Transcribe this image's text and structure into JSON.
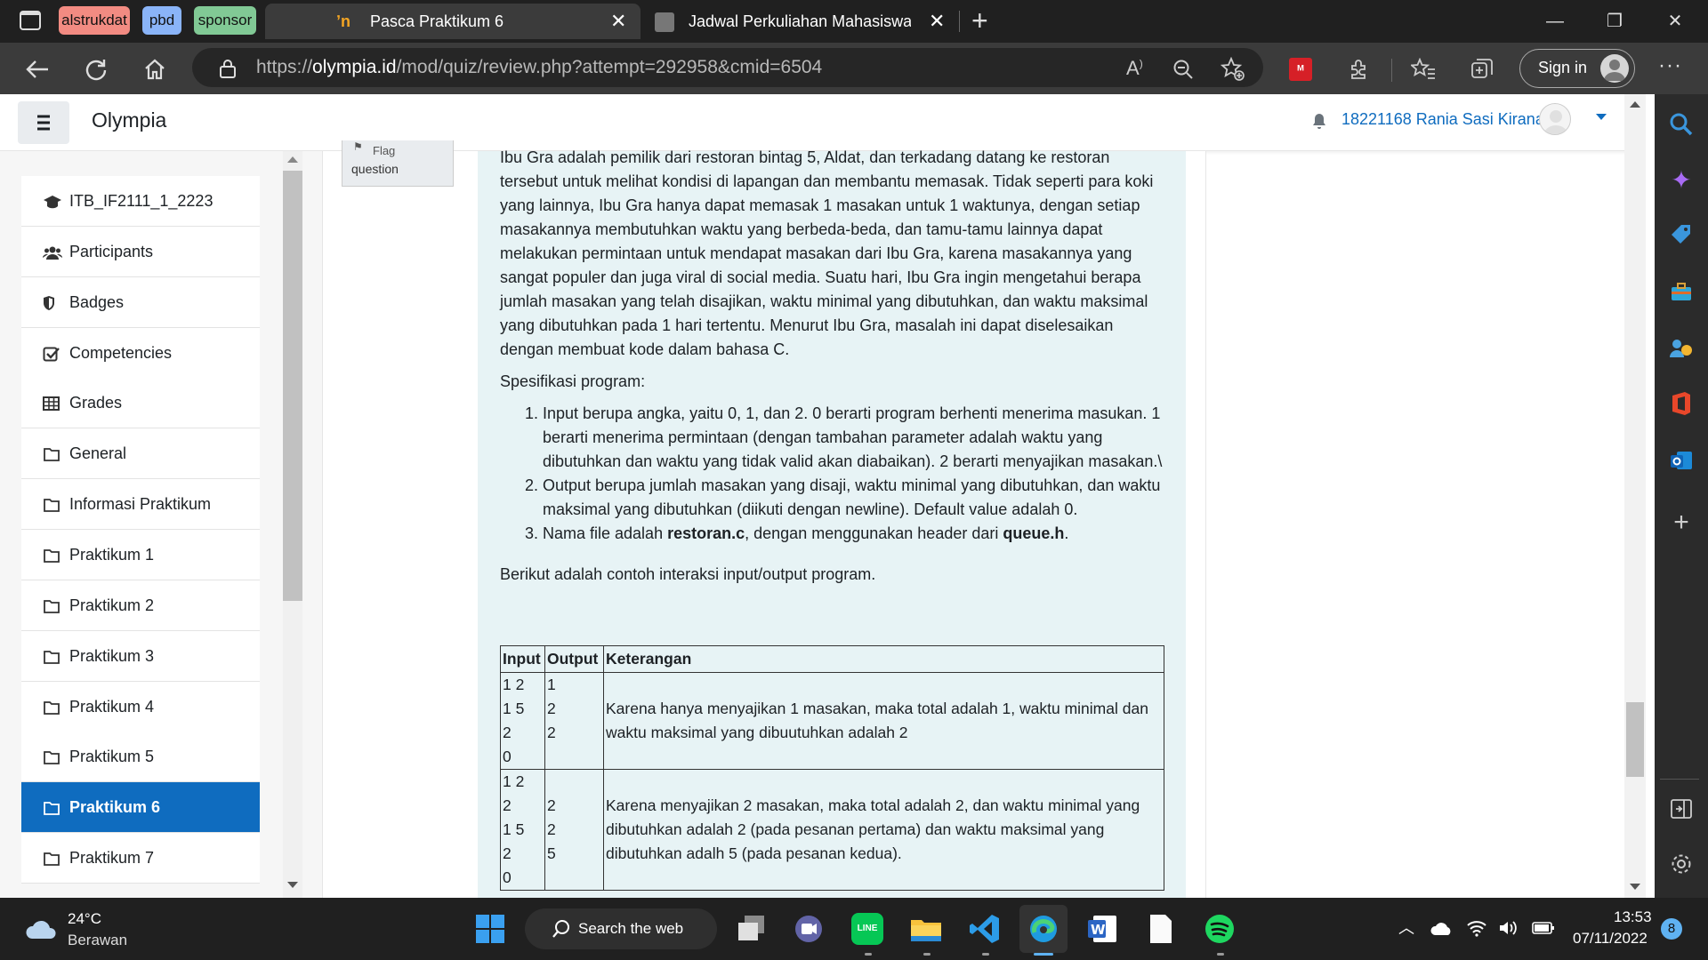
{
  "browser": {
    "tab_groups": [
      {
        "label": "alstrukdat",
        "color": "#f28b82"
      },
      {
        "label": "pbd",
        "color": "#8ab4f8"
      },
      {
        "label": "sponsor",
        "color": "#81c995"
      }
    ],
    "tabs": [
      {
        "title": "Pasca Praktikum 6",
        "active": true
      },
      {
        "title": "Jadwal Perkuliahan Mahasiswa | S",
        "active": false
      }
    ],
    "url_scheme": "https://",
    "url_host": "olympia.id",
    "url_path": "/mod/quiz/review.php?attempt=292958&cmid=6504",
    "sign_in_label": "Sign in"
  },
  "site": {
    "name": "Olympia",
    "user": "18221168 Rania Sasi Kirana"
  },
  "sidebar": {
    "items": [
      {
        "label": "ITB_IF2111_1_2223",
        "icon": "graduation-cap-icon",
        "active": false
      },
      {
        "label": "Participants",
        "icon": "users-icon",
        "active": false
      },
      {
        "label": "Badges",
        "icon": "shield-icon",
        "active": false
      },
      {
        "label": "Competencies",
        "icon": "checkbox-icon",
        "active": false
      },
      {
        "label": "Grades",
        "icon": "table-icon",
        "active": false
      },
      {
        "label": "General",
        "icon": "folder-icon",
        "active": false
      },
      {
        "label": "Informasi Praktikum",
        "icon": "folder-icon",
        "active": false
      },
      {
        "label": "Praktikum 1",
        "icon": "folder-icon",
        "active": false
      },
      {
        "label": "Praktikum 2",
        "icon": "folder-icon",
        "active": false
      },
      {
        "label": "Praktikum 3",
        "icon": "folder-icon",
        "active": false
      },
      {
        "label": "Praktikum 4",
        "icon": "folder-icon",
        "active": false
      },
      {
        "label": "Praktikum 5",
        "icon": "folder-icon",
        "active": false
      },
      {
        "label": "Praktikum 6",
        "icon": "folder-icon",
        "active": true
      },
      {
        "label": "Praktikum 7",
        "icon": "folder-icon",
        "active": false
      }
    ]
  },
  "question": {
    "flag_label_1": "Flag",
    "flag_label_2": "question",
    "intro_lines": [
      "Ibu Gra adalah pemilik dari restoran bintag 5, Aldat, dan terkadang datang ke restoran",
      "tersebut untuk melihat kondisi di lapangan dan membantu memasak. Tidak seperti para koki",
      "yang lainnya, Ibu Gra hanya dapat memasak 1 masakan untuk 1 waktunya, dengan setiap",
      "masakannya membutuhkan waktu yang berbeda-beda, dan tamu-tamu lainnya dapat",
      "melakukan permintaan untuk mendapat masakan dari Ibu Gra, karena masakannya yang",
      "sangat populer dan juga viral di social media. Suatu hari, Ibu Gra ingin mengetahui berapa",
      "jumlah masakan yang telah disajikan, waktu minimal yang dibutuhkan, dan waktu maksimal",
      "yang dibutuhkan pada 1 hari tertentu. Menurut Ibu Gra, masalah ini dapat diselesaikan",
      "dengan membuat kode dalam bahasa C."
    ],
    "spec_title": "Spesifikasi program:",
    "spec_items": [
      {
        "num": "1.",
        "lines": [
          "Input berupa angka, yaitu 0, 1, dan 2. 0 berarti program berhenti menerima masukan. 1",
          "berarti menerima permintaan (dengan tambahan parameter adalah waktu yang",
          "dibutuhkan dan waktu yang tidak valid akan diabaikan). 2 berarti menyajikan masakan.\\"
        ]
      },
      {
        "num": "2.",
        "lines": [
          "Output berupa jumlah masakan yang disaji, waktu minimal yang dibutuhkan, dan waktu",
          "maksimal yang dibutuhkan (diikuti dengan newline). Default value adalah 0."
        ]
      }
    ],
    "spec3": {
      "num": "3.",
      "a": "Nama file adalah ",
      "file": "restoran.c",
      "b": ", dengan menggunakan header dari ",
      "header": "queue.h",
      "c": "."
    },
    "example_intro": "Berikut adalah contoh interaksi input/output program.",
    "table": {
      "headers": [
        "Input",
        "Output",
        "Keterangan"
      ],
      "rows": [
        {
          "input": [
            "1 2",
            "1 5",
            "2",
            "0"
          ],
          "output": [
            "1",
            "2",
            "2"
          ],
          "note": [
            "Karena hanya menyajikan 1 masakan, maka total adalah 1, waktu minimal dan",
            "waktu maksimal yang dibuutuhkan adalah 2"
          ]
        },
        {
          "input": [
            "1 2",
            "2",
            "1 5",
            "2",
            "0"
          ],
          "output": [
            "2",
            "2",
            "5"
          ],
          "note": [
            "Karena menyajikan 2 masakan, maka total adalah 2, dan waktu minimal yang",
            "dibutuhkan adalah 2 (pada pesanan pertama) dan waktu maksimal yang",
            "dibutuhkan adalh 5 (pada pesanan kedua)."
          ]
        }
      ]
    }
  },
  "taskbar": {
    "weather_temp": "24°C",
    "weather_desc": "Berawan",
    "search_label": "Search the web",
    "time": "13:53",
    "date": "07/11/2022",
    "notification_count": "8"
  }
}
